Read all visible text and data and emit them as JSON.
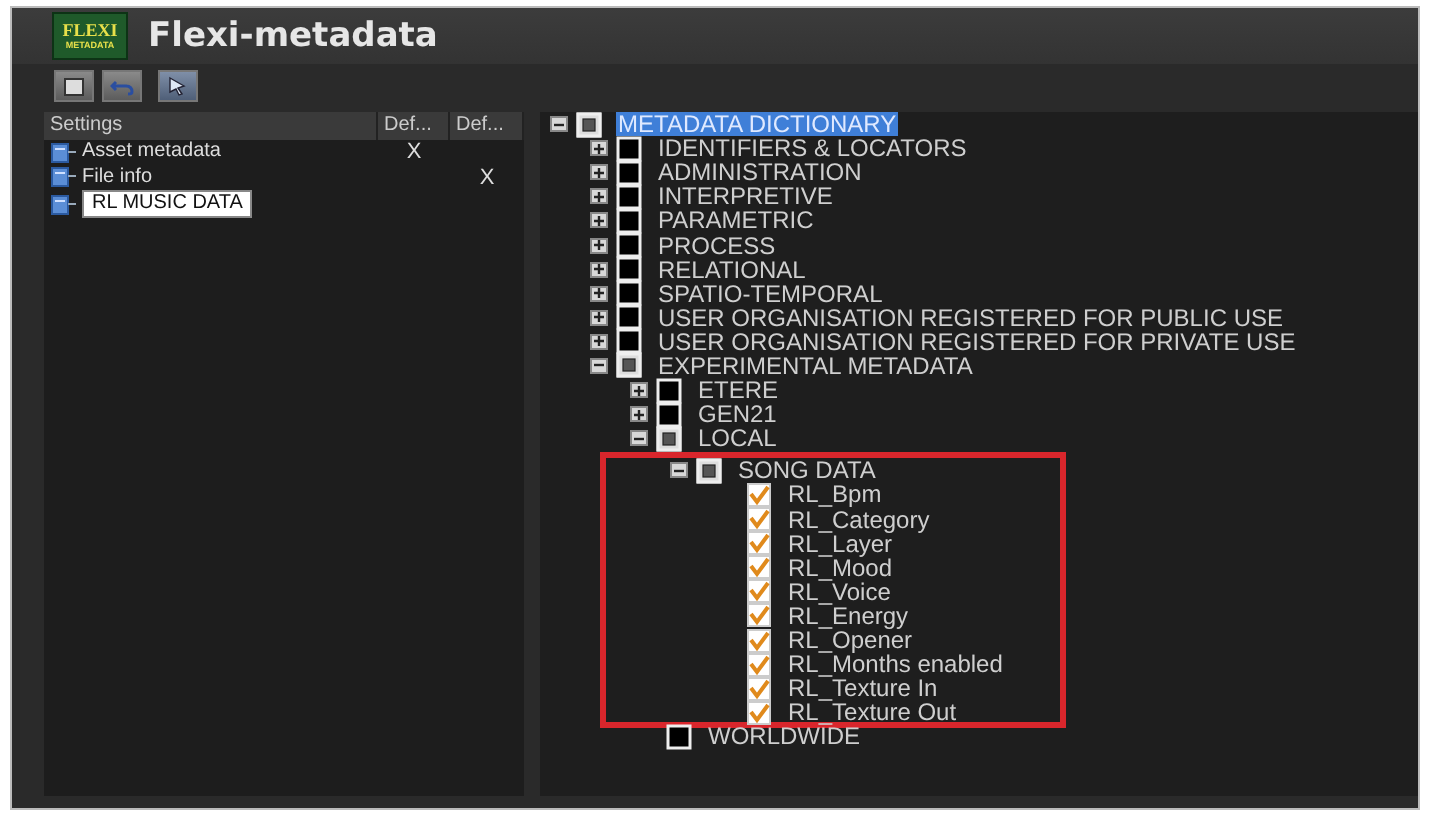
{
  "window": {
    "title": "Flexi-metadata",
    "logo": {
      "line_1": "FLEXI",
      "line_2": "METADATA"
    }
  },
  "settings": {
    "columns": [
      "Settings",
      "Def...",
      "Def..."
    ],
    "rows": [
      {
        "label": "Asset metadata",
        "default_1": "X",
        "editing": false
      },
      {
        "label": "File info",
        "default_2": "X",
        "editing": false
      },
      {
        "label": "RL MUSIC DATA",
        "editing": true
      }
    ]
  },
  "tree": [
    {
      "label": "METADATA DICTIONARY",
      "expanded": true,
      "checked": false,
      "indeterminate": true,
      "selected": true,
      "children": [
        {
          "label": "IDENTIFIERS & LOCATORS",
          "expanded": false,
          "checked": false,
          "indeterminate": false,
          "selected": false
        },
        {
          "label": "ADMINISTRATION",
          "expanded": false,
          "checked": false,
          "indeterminate": false,
          "selected": false
        },
        {
          "label": "INTERPRETIVE",
          "expanded": false,
          "checked": false,
          "indeterminate": false,
          "selected": false
        },
        {
          "label": "PARAMETRIC",
          "expanded": false,
          "checked": false,
          "indeterminate": false,
          "selected": false
        },
        {
          "label": "PROCESS",
          "expanded": false,
          "checked": false,
          "indeterminate": false,
          "selected": false
        },
        {
          "label": "RELATIONAL",
          "expanded": false,
          "checked": false,
          "indeterminate": false,
          "selected": false
        },
        {
          "label": "SPATIO-TEMPORAL",
          "expanded": false,
          "checked": false,
          "indeterminate": false,
          "selected": false
        },
        {
          "label": "USER ORGANISATION REGISTERED FOR PUBLIC USE",
          "expanded": false,
          "checked": false,
          "indeterminate": false,
          "selected": false
        },
        {
          "label": "USER ORGANISATION REGISTERED FOR PRIVATE USE",
          "expanded": false,
          "checked": false,
          "indeterminate": false,
          "selected": false
        },
        {
          "label": "EXPERIMENTAL METADATA",
          "expanded": true,
          "checked": false,
          "indeterminate": true,
          "selected": false,
          "children": [
            {
              "label": "ETERE",
              "expanded": false,
              "checked": false,
              "indeterminate": false,
              "selected": false
            },
            {
              "label": "GEN21",
              "expanded": false,
              "checked": false,
              "indeterminate": false,
              "selected": false
            },
            {
              "label": "LOCAL",
              "expanded": true,
              "checked": false,
              "indeterminate": true,
              "selected": false,
              "children": [
                {
                  "label": "SONG DATA",
                  "expanded": true,
                  "checked": false,
                  "indeterminate": true,
                  "selected": false,
                  "highlighted": true,
                  "children": [
                    {
                      "label": "RL_Bpm",
                      "checked": true,
                      "indeterminate": false,
                      "selected": false
                    },
                    {
                      "label": "RL_Category",
                      "checked": true,
                      "indeterminate": false,
                      "selected": false
                    },
                    {
                      "label": "RL_Layer",
                      "checked": true,
                      "indeterminate": false,
                      "selected": false
                    },
                    {
                      "label": "RL_Mood",
                      "checked": true,
                      "indeterminate": false,
                      "selected": false
                    },
                    {
                      "label": "RL_Voice",
                      "checked": true,
                      "indeterminate": false,
                      "selected": false
                    },
                    {
                      "label": "RL_Energy",
                      "checked": true,
                      "indeterminate": false,
                      "selected": false
                    },
                    {
                      "label": "RL_Opener",
                      "checked": true,
                      "indeterminate": false,
                      "selected": false
                    },
                    {
                      "label": "RL_Months enabled",
                      "checked": true,
                      "indeterminate": false,
                      "selected": false
                    },
                    {
                      "label": "RL_Texture In",
                      "checked": true,
                      "indeterminate": false,
                      "selected": false
                    },
                    {
                      "label": "RL_Texture Out",
                      "checked": true,
                      "indeterminate": false,
                      "selected": false
                    }
                  ]
                }
              ]
            },
            {
              "label": "WORLDWIDE",
              "checked": false,
              "indeterminate": false,
              "selected": false
            }
          ]
        }
      ]
    }
  ]
}
